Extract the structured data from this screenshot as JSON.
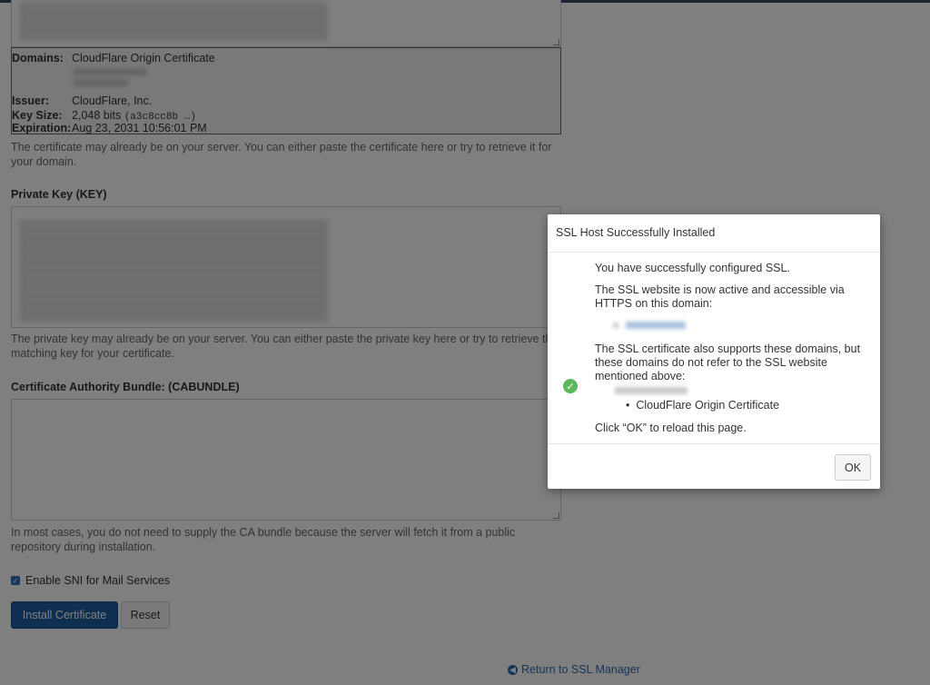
{
  "certificate": {
    "domains_label": "Domains:",
    "domains_value": "CloudFlare Origin Certificate",
    "issuer_label": "Issuer:",
    "issuer_value": "CloudFlare, Inc.",
    "keysize_label": "Key Size:",
    "keysize_value": "2,048 bits",
    "keysize_hash": "(a3c8cc8b …)",
    "expiration_label": "Expiration:",
    "expiration_value": "Aug 23, 2031 10:56:01 PM",
    "help": "The certificate may already be on your server. You can either paste the certificate here or try to retrieve it for your domain."
  },
  "private_key": {
    "label": "Private Key (KEY)",
    "help": "The private key may already be on your server. You can either paste the private key here or try to retrieve the matching key for your certificate."
  },
  "cabundle": {
    "label": "Certificate Authority Bundle: (CABUNDLE)",
    "help": "In most cases, you do not need to supply the CA bundle because the server will fetch it from a public repository during installation."
  },
  "sni": {
    "label": "Enable SNI for Mail Services",
    "checked": true
  },
  "buttons": {
    "install": "Install Certificate",
    "reset": "Reset"
  },
  "return_link": "Return to SSL Manager",
  "modal": {
    "title": "SSL Host Successfully Installed",
    "line1": "You have successfully configured SSL.",
    "line2": "The SSL website is now active and accessible via HTTPS on this domain:",
    "line3": "The SSL certificate also supports these domains, but these domains do not refer to the SSL website mentioned above:",
    "domain_item": "CloudFlare Origin Certificate",
    "line4": "Click “OK” to reload this page.",
    "ok": "OK"
  },
  "colors": {
    "primary": "#1f5fa3",
    "success": "#5cb85c",
    "link": "#2a6db0"
  }
}
